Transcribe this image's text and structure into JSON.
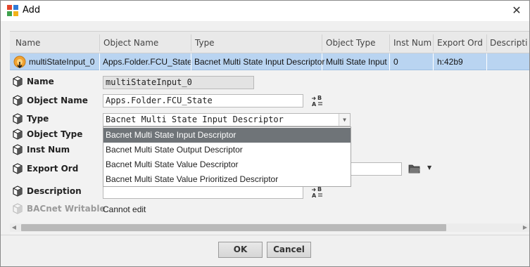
{
  "window": {
    "title": "Add",
    "close_glyph": "✕"
  },
  "table": {
    "columns": [
      "Name",
      "Object Name",
      "Type",
      "Object Type",
      "Inst Num",
      "Export Ord",
      "Descripti"
    ],
    "row": {
      "name": "multiStateInput_0",
      "object_name": "Apps.Folder.FCU_State",
      "type": "Bacnet Multi State Input Descriptor",
      "object_type": "Multi State Input",
      "inst_num": "0",
      "export_ord": "h:42b9",
      "description": ""
    }
  },
  "props": {
    "name": {
      "label": "Name",
      "value": "multiStateInput_0"
    },
    "object_name": {
      "label": "Object Name",
      "value": "Apps.Folder.FCU_State"
    },
    "type": {
      "label": "Type",
      "value": "Bacnet Multi State Input Descriptor"
    },
    "object_type": {
      "label": "Object Type"
    },
    "inst_num": {
      "label": "Inst Num"
    },
    "export_ord": {
      "label": "Export Ord",
      "value": ""
    },
    "description": {
      "label": "Description",
      "value": ""
    },
    "bacnet_writable": {
      "label": "BACnet Writable",
      "value": "Cannot edit"
    }
  },
  "dropdown": {
    "options": [
      "Bacnet Multi State Input Descriptor",
      "Bacnet Multi State Output Descriptor",
      "Bacnet Multi State Value Descriptor",
      "Bacnet Multi State Value Prioritized Descriptor"
    ],
    "selected_index": 0
  },
  "buttons": {
    "ok": "OK",
    "cancel": "Cancel"
  },
  "icons": {
    "app": "niagara-app-icon",
    "row": "bacnet-point-icon",
    "prop": "slot-cube-icon",
    "ab": "ab-sort-icon",
    "folder": "folder-icon",
    "chevron": "chevron-down-icon"
  },
  "colors": {
    "selection": "#b9d4f1",
    "dropdown_selected": "#6f7478"
  }
}
